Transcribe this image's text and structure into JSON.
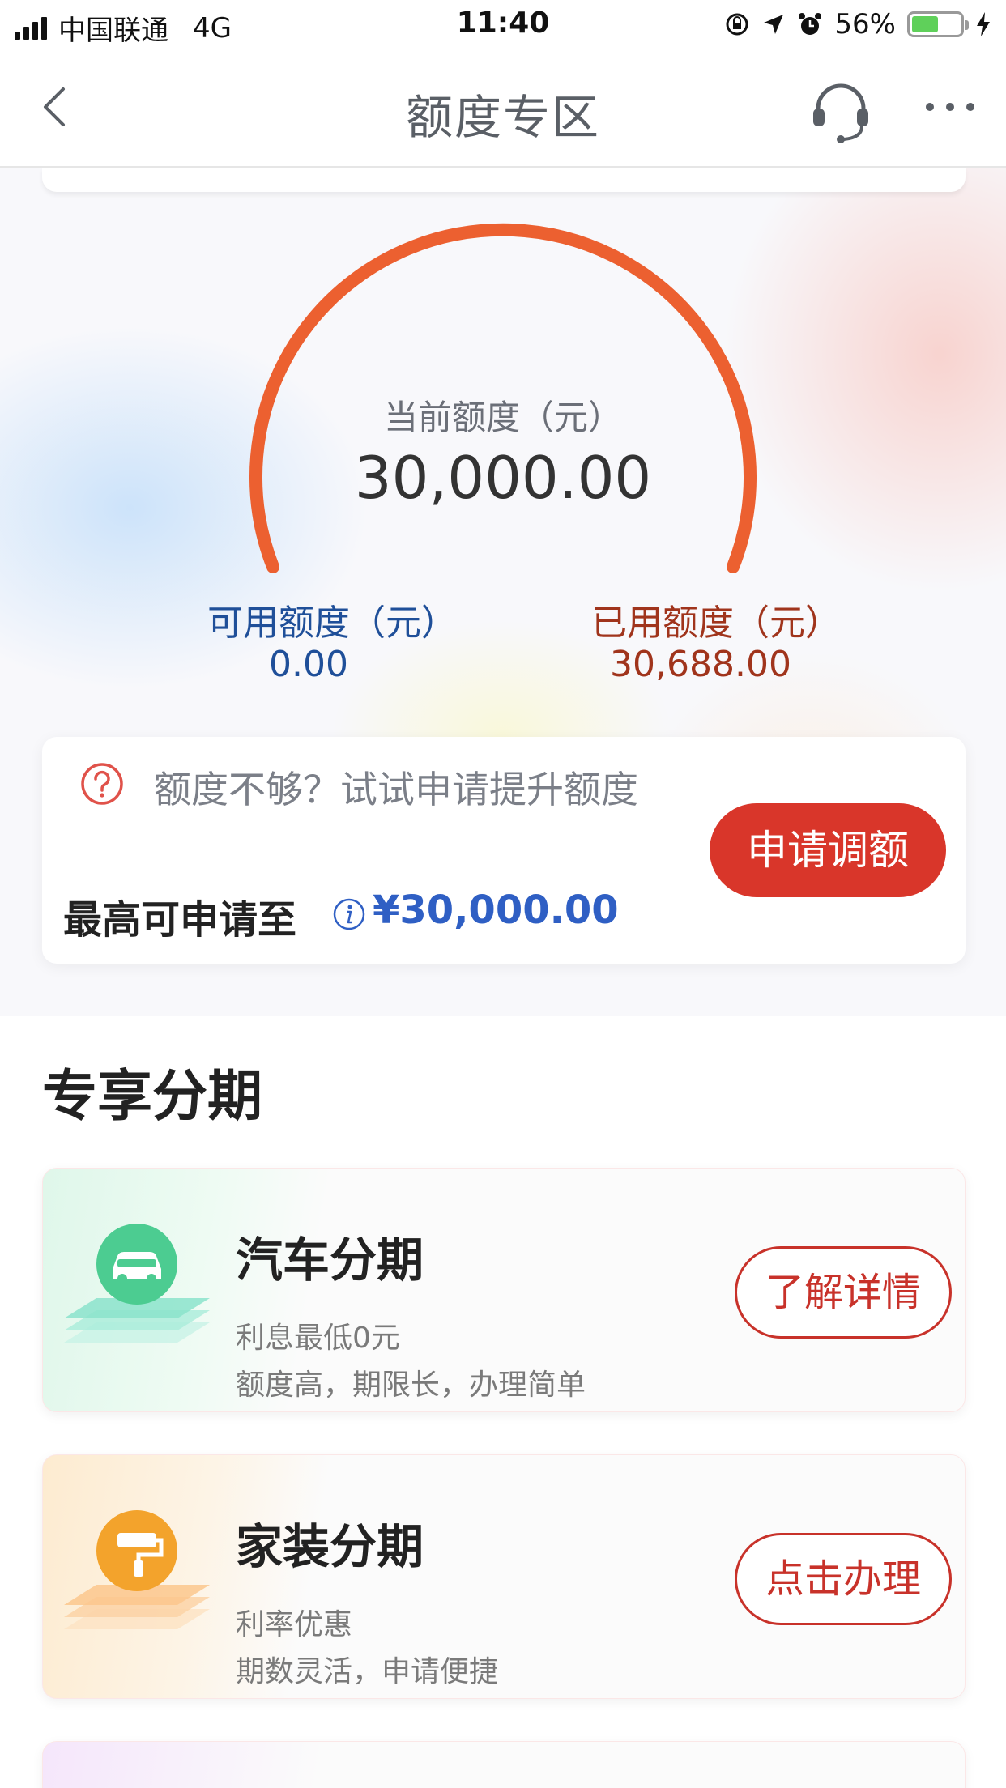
{
  "status_bar": {
    "carrier": "中国联通",
    "network": "4G",
    "time": "11:40",
    "battery_text": "56%",
    "battery_level": 0.56,
    "battery_color": "#5fd05a"
  },
  "nav": {
    "title": "额度专区",
    "back_icon": "chevron-left-icon",
    "support_icon": "headset-icon",
    "more_icon": "more-dots-icon"
  },
  "credit": {
    "current_label": "当前额度（元）",
    "current_value": "30,000.00",
    "available_label": "可用额度（元）",
    "available_value": "0.00",
    "used_label": "已用额度（元）",
    "used_value": "30,688.00",
    "gauge_color": "#ec6030",
    "available_color": "#1f4f99",
    "used_color": "#a0341c"
  },
  "raise": {
    "prompt": "额度不够？试试申请提升额度",
    "max_label": "最高可申请至",
    "max_value": "¥30,000.00",
    "button_label": "申请调额",
    "button_color": "#d9362a"
  },
  "section": {
    "title": "专享分期"
  },
  "products": [
    {
      "title": "汽车分期",
      "line1": "利息最低0元",
      "line2": "额度高，期限长，办理简单",
      "button_label": "了解详情",
      "icon": "car-icon",
      "accent": "#4ccc91"
    },
    {
      "title": "家装分期",
      "line1": "利率优惠",
      "line2": "期数灵活，申请便捷",
      "button_label": "点击办理",
      "icon": "paint-roller-icon",
      "accent": "#f3a32c"
    }
  ]
}
